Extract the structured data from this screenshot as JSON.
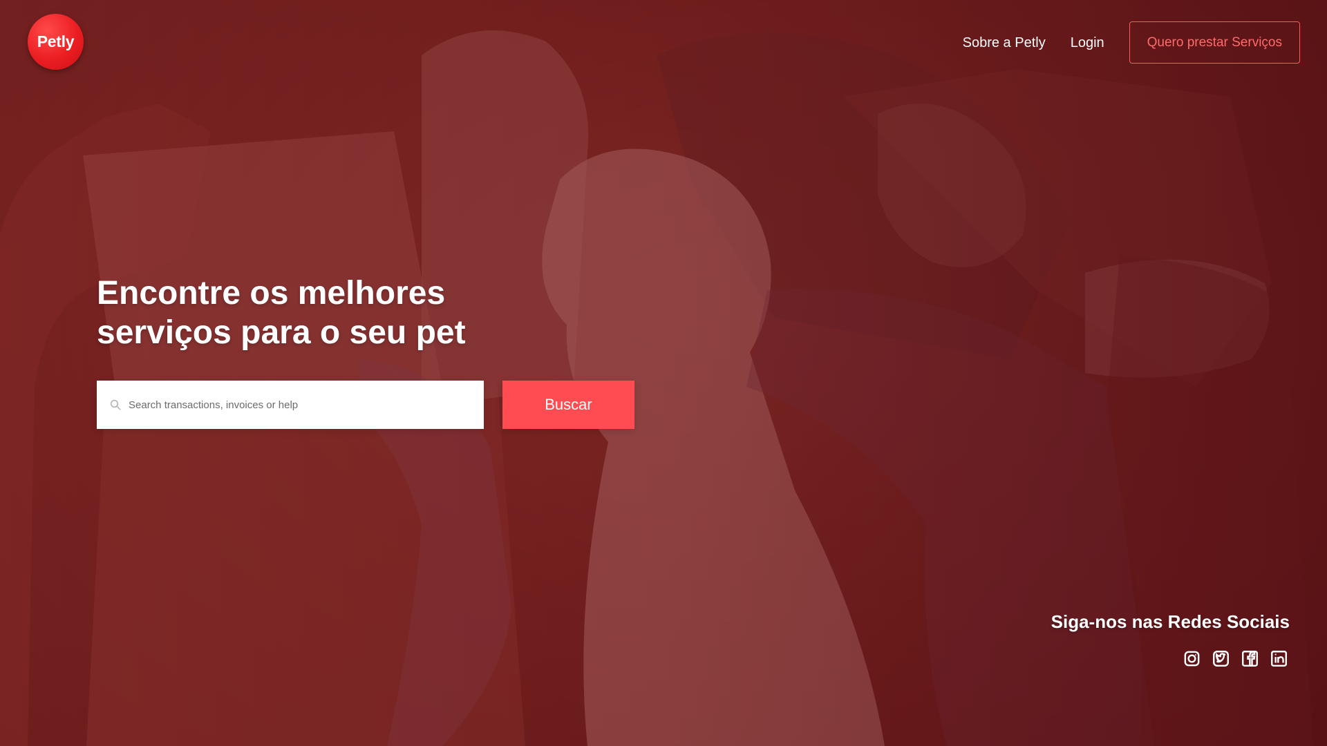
{
  "brand": {
    "logo_text": "Petly",
    "accent": "#ff4c52",
    "logo_fill": "#eb1e22"
  },
  "nav": {
    "items": [
      {
        "label": "Sobre a Petly"
      },
      {
        "label": "Login"
      }
    ],
    "provider_button": "Quero prestar Serviços"
  },
  "hero": {
    "headline_line_1": "Encontre os melhores",
    "headline_line_2": "serviços para o seu pet",
    "search_placeholder": "Search transactions, invoices or help",
    "search_icon": "search-icon",
    "search_button": "Buscar"
  },
  "social": {
    "title": "Siga-nos nas Redes Sociais",
    "icons": [
      {
        "name": "instagram-icon"
      },
      {
        "name": "twitter-icon"
      },
      {
        "name": "facebook-icon"
      },
      {
        "name": "linkedin-icon"
      }
    ]
  }
}
